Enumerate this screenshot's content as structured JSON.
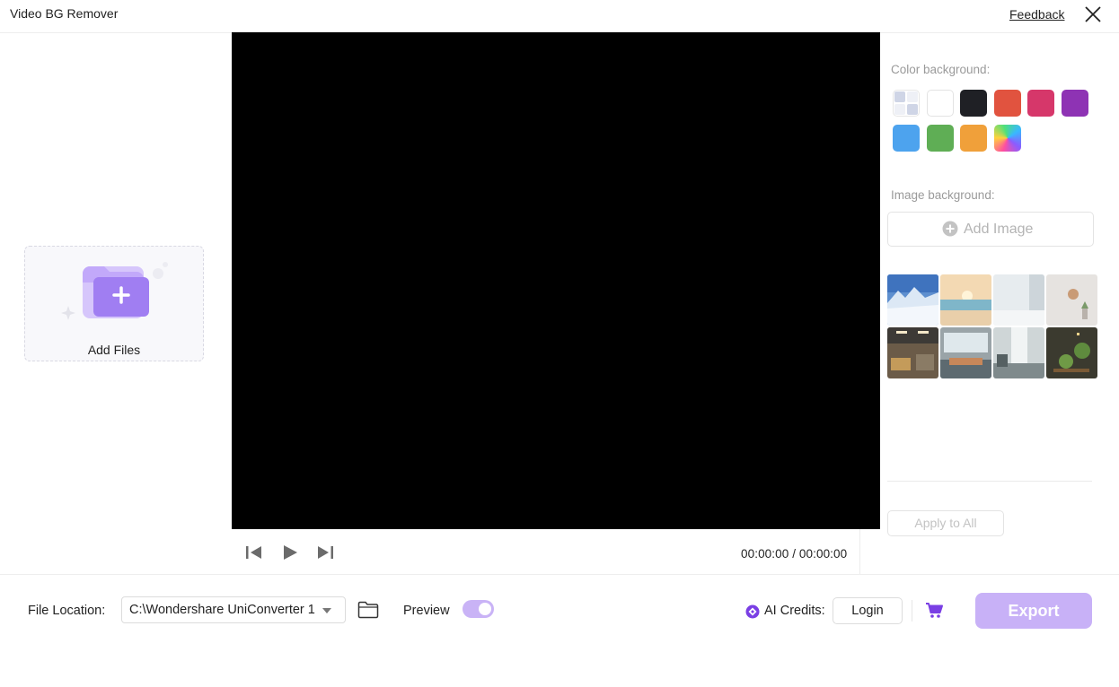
{
  "window": {
    "title": "Video BG Remover",
    "feedback_label": "Feedback",
    "close_icon": "close-icon"
  },
  "left": {
    "add_files_label": "Add Files",
    "icon": "folder-plus-icon"
  },
  "player": {
    "time": "00:00:00 / 00:00:00",
    "icons": [
      "previous-frame-icon",
      "play-icon",
      "next-frame-icon"
    ]
  },
  "right": {
    "color_label": "Color background:",
    "colors": [
      "transparent",
      "#ffffff",
      "#1f2025",
      "#e1533f",
      "#d6376a",
      "#8e33b4",
      "#4da3ee",
      "#5fae55",
      "#f0a03a",
      "gradient"
    ],
    "image_label": "Image background:",
    "add_image_label": "Add Image",
    "thumbnails": [
      "mountain-snow",
      "beach-sunset",
      "white-room",
      "beige-wall",
      "office-lounge",
      "meeting-room",
      "bright-office",
      "plant-shelf"
    ],
    "apply_all_label": "Apply to All"
  },
  "bottom": {
    "file_location_label": "File Location:",
    "path_value": "C:\\Wondershare UniConverter 1",
    "preview_label": "Preview",
    "preview_on": true,
    "ai_credits_label": "AI Credits:",
    "login_label": "Login",
    "export_label": "Export",
    "accent": "#c8b1f7"
  }
}
